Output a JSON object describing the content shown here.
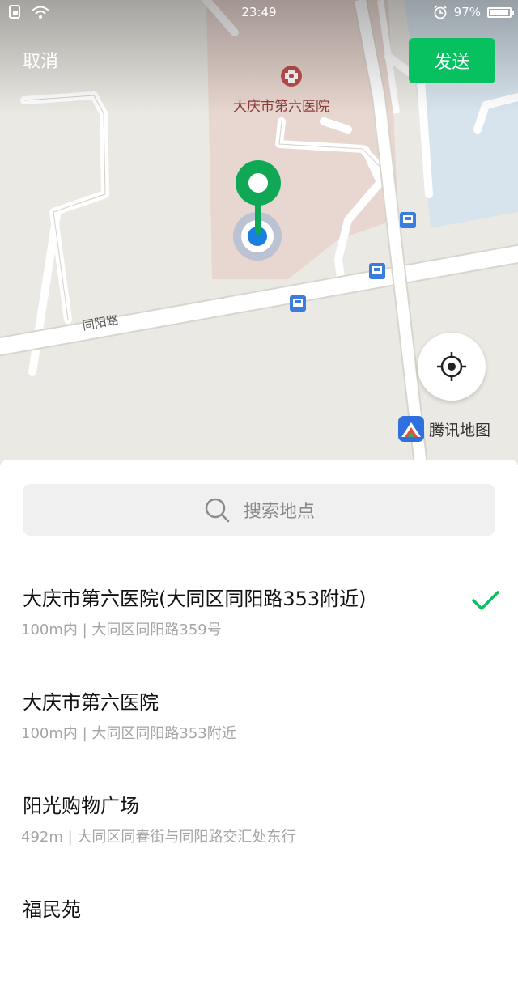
{
  "status_bar": {
    "time": "23:49",
    "battery": "97%",
    "battery_level": 0.97,
    "icons": [
      "sim-icon",
      "wifi-icon",
      "alarm-icon",
      "battery-icon"
    ]
  },
  "header": {
    "cancel_label": "取消",
    "send_label": "发送"
  },
  "map": {
    "poi_label": "大庆市第六医院",
    "road_label": "同阳路",
    "logo_text": "腾讯地图",
    "icons": [
      "hospital-icon",
      "location-pin-icon",
      "current-location-dot-icon",
      "bus-stop-icon",
      "locate-crosshair-icon",
      "tencent-map-logo-icon"
    ]
  },
  "search": {
    "placeholder": "搜索地点"
  },
  "results": [
    {
      "name": "大庆市第六医院(大同区同阳路353附近)",
      "address": "100m内 | 大同区同阳路359号",
      "selected": true
    },
    {
      "name": "大庆市第六医院",
      "address": "100m内 | 大同区同阳路353附近",
      "selected": false
    },
    {
      "name": "阳光购物广场",
      "address": "492m | 大同区同春街与同阳路交汇处东行",
      "selected": false
    },
    {
      "name": "福民苑",
      "address": "",
      "selected": false
    }
  ],
  "colors": {
    "accent": "#07c160",
    "pin_green": "#10a854",
    "location_blue": "#1a7fe0",
    "bus_stop_blue": "#3a7ddf",
    "hospital_red": "#c0504d"
  }
}
